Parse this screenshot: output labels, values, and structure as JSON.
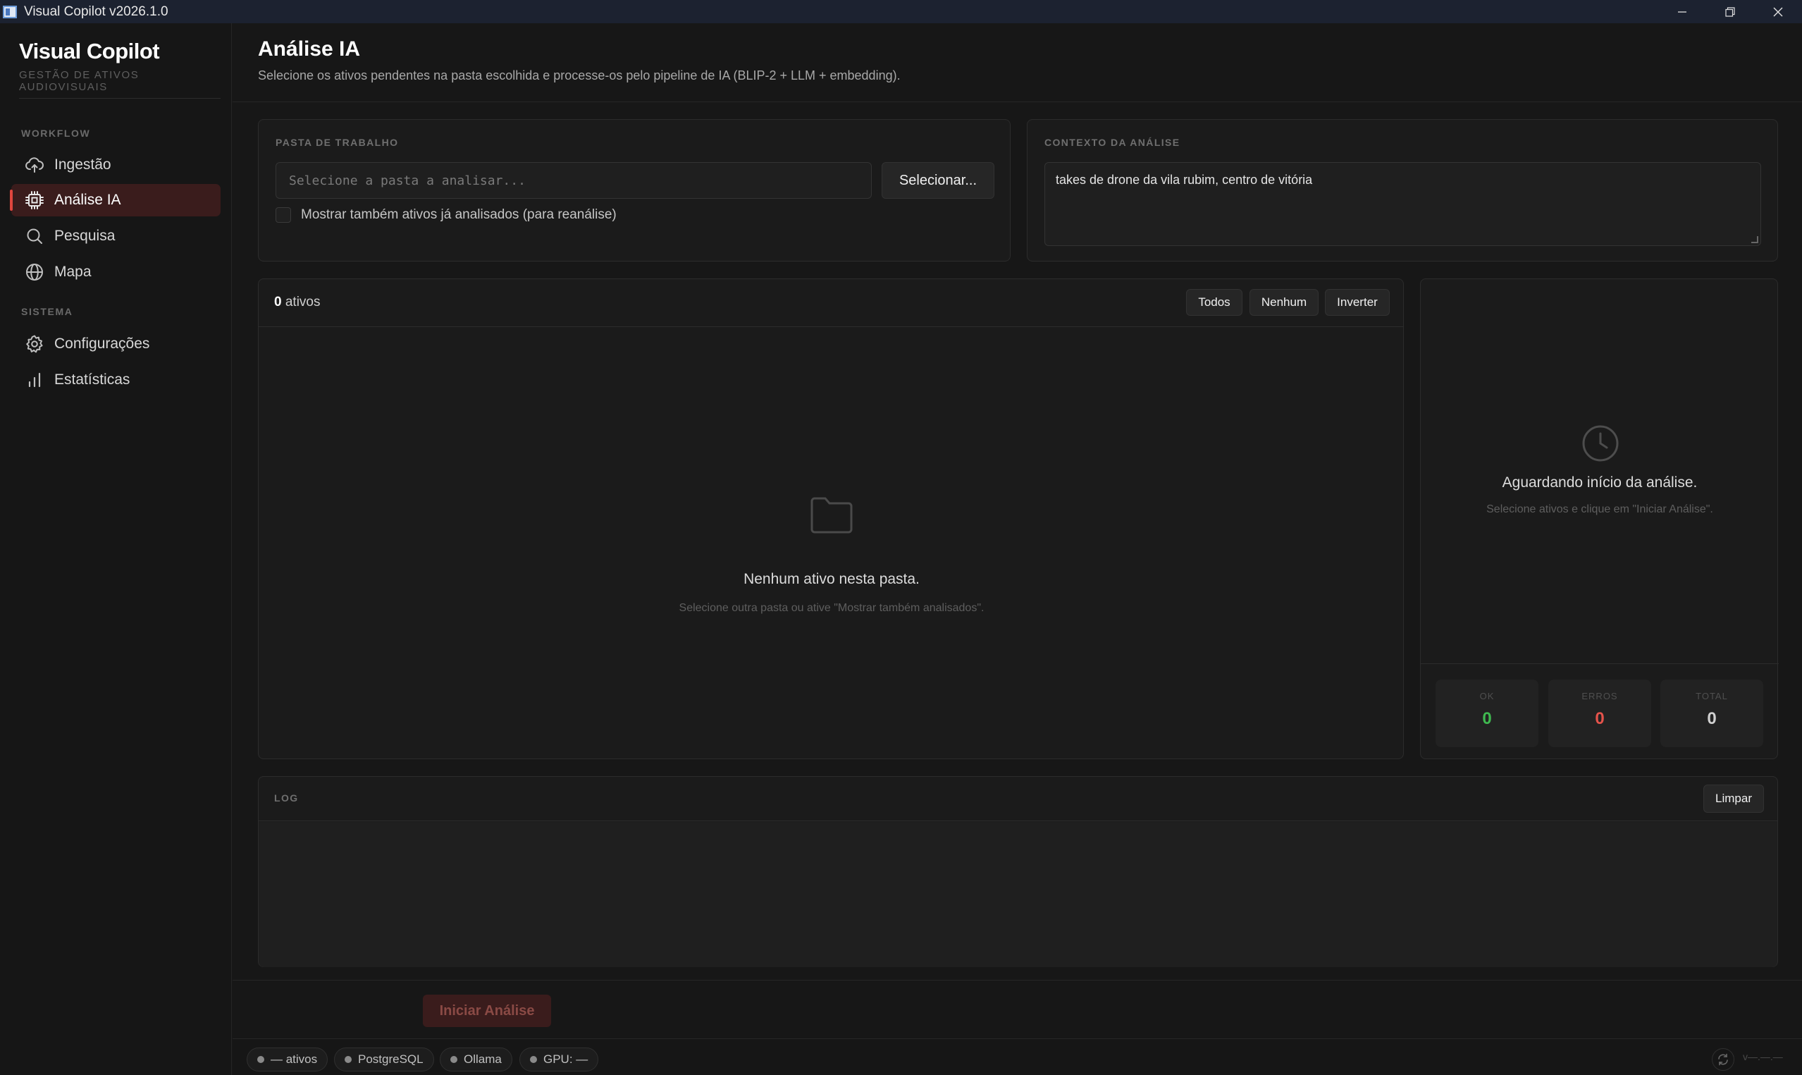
{
  "window": {
    "title": "Visual Copilot v2026.1.0",
    "controls": {
      "minimize": "–",
      "restore": "❐",
      "close": "✕"
    }
  },
  "sidebar": {
    "brand": "Visual Copilot",
    "brand_sub": "GESTÃO DE ATIVOS AUDIOVISUAIS",
    "sections": [
      {
        "label": "WORKFLOW"
      },
      {
        "label": "SISTEMA"
      }
    ],
    "items": [
      {
        "label": "Ingestão",
        "icon": "cloud-upload-icon",
        "active": false
      },
      {
        "label": "Análise IA",
        "icon": "chip-icon",
        "active": true
      },
      {
        "label": "Pesquisa",
        "icon": "search-icon",
        "active": false
      },
      {
        "label": "Mapa",
        "icon": "globe-icon",
        "active": false
      },
      {
        "label": "Configurações",
        "icon": "gear-icon",
        "active": false
      },
      {
        "label": "Estatísticas",
        "icon": "bar-chart-icon",
        "active": false
      }
    ]
  },
  "header": {
    "title": "Análise IA",
    "description": "Selecione os ativos pendentes na pasta escolhida e processe-os pelo pipeline de IA (BLIP-2 + LLM + embedding)."
  },
  "workfolder": {
    "label": "PASTA DE TRABALHO",
    "placeholder": "Selecione a pasta a analisar...",
    "select_button": "Selecionar...",
    "show_analyzed_label": "Mostrar também ativos já analisados (para reanálise)",
    "show_analyzed_checked": false
  },
  "context": {
    "label": "CONTEXTO DA ANÁLISE",
    "value": "takes de drone da vila rubim, centro de vitória"
  },
  "assets": {
    "count": "0",
    "count_suffix": "ativos",
    "buttons": {
      "all": "Todos",
      "none": "Nenhum",
      "invert": "Inverter"
    },
    "empty_title": "Nenhum ativo nesta pasta.",
    "empty_sub": "Selecione outra pasta ou ative \"Mostrar também analisados\"."
  },
  "progress": {
    "waiting_title": "Aguardando início da análise.",
    "waiting_sub": "Selecione ativos e clique em \"Iniciar Análise\".",
    "stats": [
      {
        "label": "OK",
        "value": "0",
        "color": "#3fb950"
      },
      {
        "label": "ERROS",
        "value": "0",
        "color": "#e5534b"
      },
      {
        "label": "TOTAL",
        "value": "0",
        "color": "#d0d0d0"
      }
    ]
  },
  "log": {
    "label": "LOG",
    "clear_button": "Limpar"
  },
  "footer": {
    "start_button": "Iniciar Análise"
  },
  "statusbar": {
    "pills": [
      {
        "label": "— ativos"
      },
      {
        "label": "PostgreSQL"
      },
      {
        "label": "Ollama"
      },
      {
        "label": "GPU: —"
      }
    ],
    "version": "v—.—.—"
  },
  "colors": {
    "accent": "#e0463e",
    "active_bg": "#3a1c1c",
    "start_button_bg": "#3a1c1c",
    "start_button_text": "#8a4a45"
  }
}
